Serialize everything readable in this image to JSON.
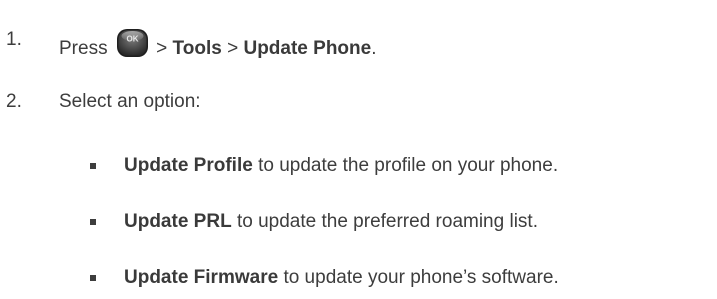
{
  "steps": [
    {
      "number": "1.",
      "press_text": "Press",
      "ok_key_label": "OK",
      "sep1": ">",
      "menu1": "Tools",
      "sep2": ">",
      "menu2": "Update Phone",
      "end": "."
    },
    {
      "number": "2.",
      "text": "Select an option:"
    }
  ],
  "options": [
    {
      "name": "Update Profile",
      "desc": "to update the profile on your phone."
    },
    {
      "name": "Update PRL",
      "desc": "to update the preferred roaming list."
    },
    {
      "name": "Update Firmware",
      "desc": "to update your phone’s software."
    }
  ],
  "icons": {
    "ok_key": "ok-key-icon",
    "bullet": "square-bullet-icon"
  },
  "colors": {
    "text": "#3d3d3d",
    "key_body": "#4a4a4a",
    "key_highlight": "#e6e6e6"
  }
}
